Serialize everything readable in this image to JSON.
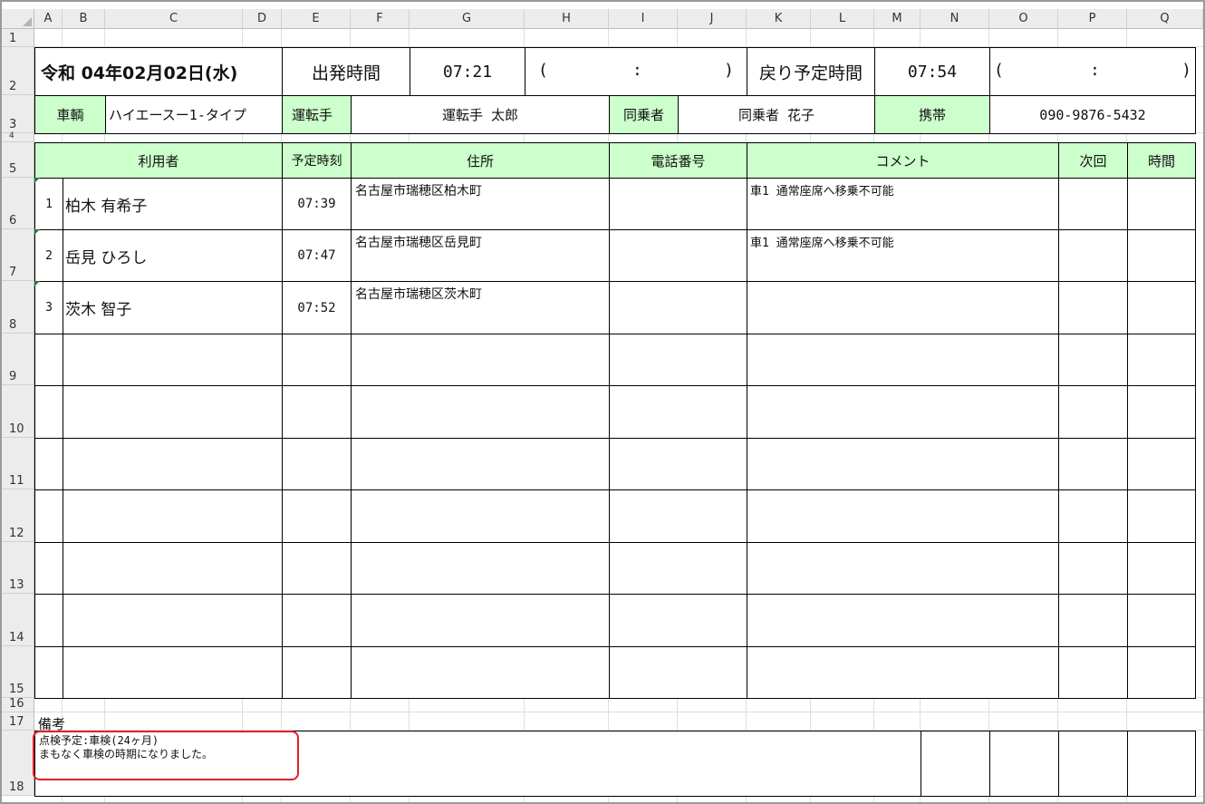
{
  "columns": [
    "A",
    "B",
    "C",
    "D",
    "E",
    "F",
    "G",
    "H",
    "I",
    "J",
    "K",
    "L",
    "M",
    "N",
    "O",
    "P",
    "Q"
  ],
  "rows": [
    "1",
    "2",
    "3",
    "4",
    "5",
    "6",
    "7",
    "8",
    "9",
    "10",
    "11",
    "12",
    "13",
    "14",
    "15",
    "16",
    "17",
    "18"
  ],
  "header": {
    "date": "令和 04年02月02日(水)",
    "depart_label": "出発時間",
    "depart_time": "07:21",
    "depart_paren_open": "(",
    "depart_paren_colon": ":",
    "depart_paren_close": ")",
    "return_label": "戻り予定時間",
    "return_time": "07:54",
    "return_paren_open": "(",
    "return_paren_colon": ":",
    "return_paren_close": ")"
  },
  "vehicle": {
    "vehicle_label": "車輌",
    "vehicle_value": "ハイエースー1-タイプ",
    "driver_label": "運転手",
    "driver_value": "運転手 太郎",
    "passenger_label": "同乗者",
    "passenger_value": "同乗者 花子",
    "mobile_label": "携帯",
    "mobile_value": "090-9876-5432"
  },
  "table": {
    "headers": {
      "user": "利用者",
      "time": "予定時刻",
      "address": "住所",
      "phone": "電話番号",
      "comment": "コメント",
      "next": "次回",
      "hours": "時間"
    },
    "rows": [
      {
        "no": "1",
        "name": "柏木 有希子",
        "time": "07:39",
        "address": "名古屋市瑞穂区柏木町",
        "phone": "",
        "comment": "車1 通常座席へ移乗不可能"
      },
      {
        "no": "2",
        "name": "岳見 ひろし",
        "time": "07:47",
        "address": "名古屋市瑞穂区岳見町",
        "phone": "",
        "comment": "車1 通常座席へ移乗不可能"
      },
      {
        "no": "3",
        "name": "茨木 智子",
        "time": "07:52",
        "address": "名古屋市瑞穂区茨木町",
        "phone": "",
        "comment": ""
      }
    ]
  },
  "notes": {
    "label": "備考",
    "line1": "点検予定:車検(24ヶ月)",
    "line2": "まもなく車検の時期になりました。"
  },
  "colors": {
    "header_green": "#ccffcc",
    "highlight_red": "#e0202a",
    "comment_marker": "#1f7a3a"
  }
}
